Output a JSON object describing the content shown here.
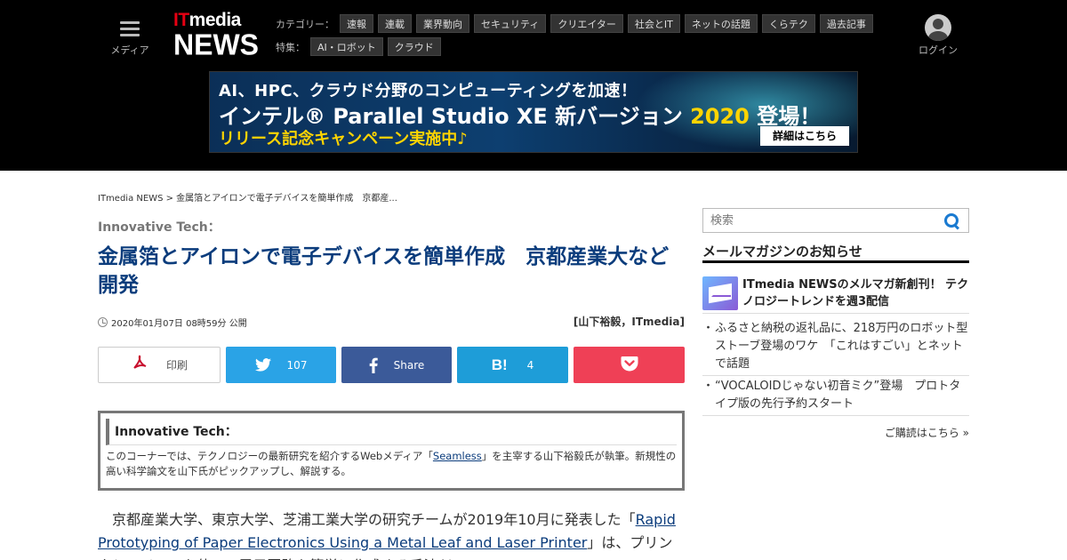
{
  "header": {
    "menu_label": "メディア",
    "logo_top_it": "IT",
    "logo_top_rest": "media",
    "logo_bottom": "NEWS",
    "category_label": "カテゴリー：",
    "categories": [
      "速報",
      "連載",
      "業界動向",
      "セキュリティ",
      "クリエイター",
      "社会とIT",
      "ネットの話題",
      "くらテク",
      "過去記事"
    ],
    "feature_label": "特集：",
    "features": [
      "AI・ロボット",
      "クラウド"
    ],
    "login_label": "ログイン"
  },
  "banner": {
    "line1": "AI、HPC、クラウド分野のコンピューティングを加速！",
    "line2_pre": "インテル® Parallel Studio XE 新バージョン ",
    "line2_year": "2020",
    "line2_post": " 登場！",
    "line3": "リリース記念キャンペーン実施中♪",
    "cta": "詳細はこちら"
  },
  "breadcrumb": {
    "home": "ITmedia NEWS",
    "sep": " > ",
    "current": "金属箔とアイロンで電子デバイスを簡単作成　京都産..."
  },
  "article": {
    "series": "Innovative Tech：",
    "title": "金属箔とアイロンで電子デバイスを簡単作成　京都産業大など開発",
    "date": "2020年01月07日 08時59分 公開",
    "author": "[山下裕毅，ITmedia]",
    "box_title": "Innovative Tech：",
    "box_body_pre": "このコーナーでは、テクノロジーの最新研究を紹介するWebメディア「",
    "box_body_link": "Seamless",
    "box_body_post": "」を主宰する山下裕毅氏が執筆。新規性の高い科学論文を山下氏がピックアップし、解説する。",
    "body_pre": "京都産業大学、東京大学、芝浦工業大学の研究チームが2019年10月に発表した「",
    "body_link": "Rapid Prototyping of Paper Electronics Using a Metal Leaf and Laser Printer",
    "body_post": "」は、プリンタとアイロンを使って電子回路を簡単に作成する手法だ。"
  },
  "share": {
    "print": "印刷",
    "twitter_count": "107",
    "facebook": "Share",
    "hatena_icon": "B!",
    "hatena_count": "4"
  },
  "sidebar": {
    "search_placeholder": "検索",
    "mm_heading": "メールマガジンのお知らせ",
    "mm_lead": "ITmedia NEWSのメルマガ新創刊！ テクノロジートレンドを週3配信",
    "mm_items": [
      "ふるさと納税の返礼品に、218万円のロボット型ストーブ登場のワケ　「これはすごい」とネットで話題",
      "“VOCALOIDじゃない初音ミク”登場　プロトタイプ版の先行予約スタート"
    ],
    "mm_more": "ご購読はこちら »"
  },
  "colors": {
    "header_bg": "#000000",
    "title": "#0b3c7c",
    "twitter": "#2aa3e6",
    "facebook": "#3b5a99",
    "hatena": "#1e9dd8",
    "pocket": "#ef4056",
    "logo_accent": "#e60012"
  }
}
